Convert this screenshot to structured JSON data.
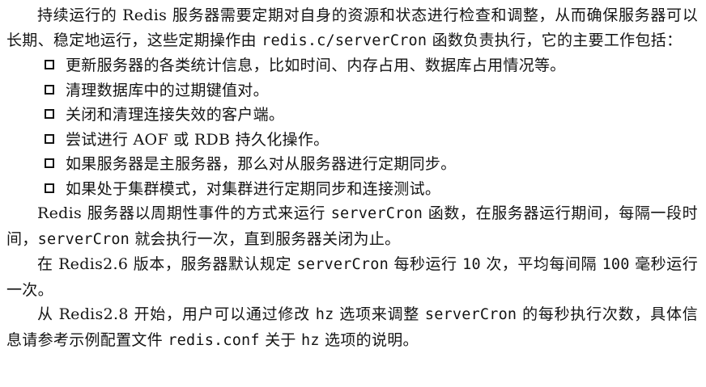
{
  "intro": {
    "part1": "持续运行的 Redis 服务器需要定期对自身的资源和状态进行检查和调整，从而确保服务器可以长期、稳定地运行，这些定期操作由 ",
    "code1": "redis.c/serverCron",
    "part2": " 函数负责执行，它的主要工作包括："
  },
  "bullets": [
    {
      "text": "更新服务器的各类统计信息，比如时间、内存占用、数据库占用情况等。",
      "icon": "checkbox-icon"
    },
    {
      "text": "清理数据库中的过期键值对。",
      "icon": "checkbox-icon"
    },
    {
      "text": "关闭和清理连接失效的客户端。",
      "icon": "checkbox-icon"
    },
    {
      "text": "尝试进行 AOF 或 RDB 持久化操作。",
      "icon": "checkbox-icon"
    },
    {
      "text": "如果服务器是主服务器，那么对从服务器进行定期同步。",
      "icon": "checkbox-icon"
    },
    {
      "text": "如果处于集群模式，对集群进行定期同步和连接测试。",
      "icon": "checkbox-icon"
    }
  ],
  "para2": {
    "part1": "Redis 服务器以周期性事件的方式来运行 ",
    "code1": "serverCron",
    "part2": " 函数，在服务器运行期间，每隔一段时间，",
    "code2": "serverCron",
    "part3": " 就会执行一次，直到服务器关闭为止。"
  },
  "para3": {
    "part1": "在 Redis2.6 版本，服务器默认规定 ",
    "code1": "serverCron",
    "part2": " 每秒运行 ",
    "code2": "10",
    "part3": " 次，平均每间隔 ",
    "code3": "100",
    "part4": " 毫秒运行一次。"
  },
  "para4": {
    "part1": "从 Redis2.8 开始，用户可以通过修改 ",
    "code1": "hz",
    "part2": " 选项来调整 ",
    "code2": "serverCron",
    "part3": " 的每秒执行次数，具体信息请参考示例配置文件 ",
    "code3": "redis.conf",
    "part4": " 关于 ",
    "code4": "hz",
    "part5": " 选项的说明。"
  }
}
